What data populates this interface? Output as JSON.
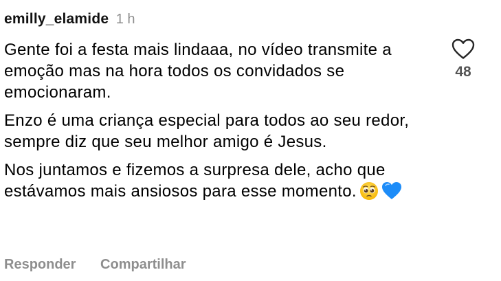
{
  "comment": {
    "username": "emilly_elamide",
    "time": "1 h",
    "paragraphs": [
      "Gente foi a festa mais lindaaa, no vídeo transmite a emoção mas na hora todos os convidados se emocionaram.",
      "Enzo é uma criança especial para todos ao seu redor, sempre diz que seu melhor amigo é Jesus.",
      "Nos juntamos e fizemos a surpresa dele, acho que estávamos mais ansiosos para esse momento."
    ],
    "emojis": [
      "pleading-face-emoji",
      "blue-heart-emoji"
    ]
  },
  "like": {
    "icon": "heart-outline-icon",
    "count": "48"
  },
  "actions": {
    "reply_label": "Responder",
    "share_label": "Compartilhar"
  },
  "colors": {
    "text": "#000000",
    "muted": "#8e8e8e",
    "blue_heart": "#1d8cf8"
  }
}
